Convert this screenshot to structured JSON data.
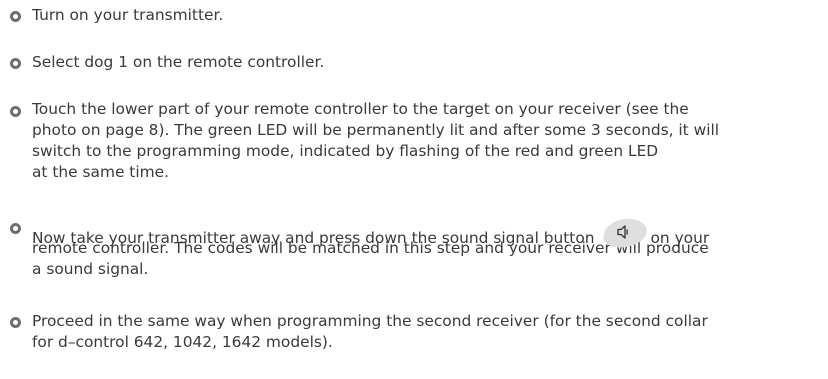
{
  "steps": [
    {
      "lines": [
        "Turn on your transmitter."
      ]
    },
    {
      "lines": [
        "Select dog 1 on the remote controller."
      ]
    },
    {
      "lines": [
        "Touch the lower part of your remote controller to the target on your receiver (see the",
        "photo on page 8). The green LED will be permanently lit and after some 3 seconds, it will",
        "switch to the programming mode, indicated by flashing of the red and green LED",
        "at the same time."
      ]
    },
    {
      "line1_before": "Now take your transmitter away and press down the sound signal button",
      "line1_after": "on your",
      "icon": "speaker-icon",
      "lines": [
        "remote controller. The codes will be matched in this step and your receiver will produce",
        "a sound signal."
      ]
    },
    {
      "lines": [
        "Proceed in the same way when programming the second receiver (for the second collar",
        "for d–control 642, 1042, 1642 models)."
      ]
    }
  ],
  "colors": {
    "text": "#3a3a3a",
    "bullet": "#6e6e6e",
    "button": "#dedede"
  }
}
